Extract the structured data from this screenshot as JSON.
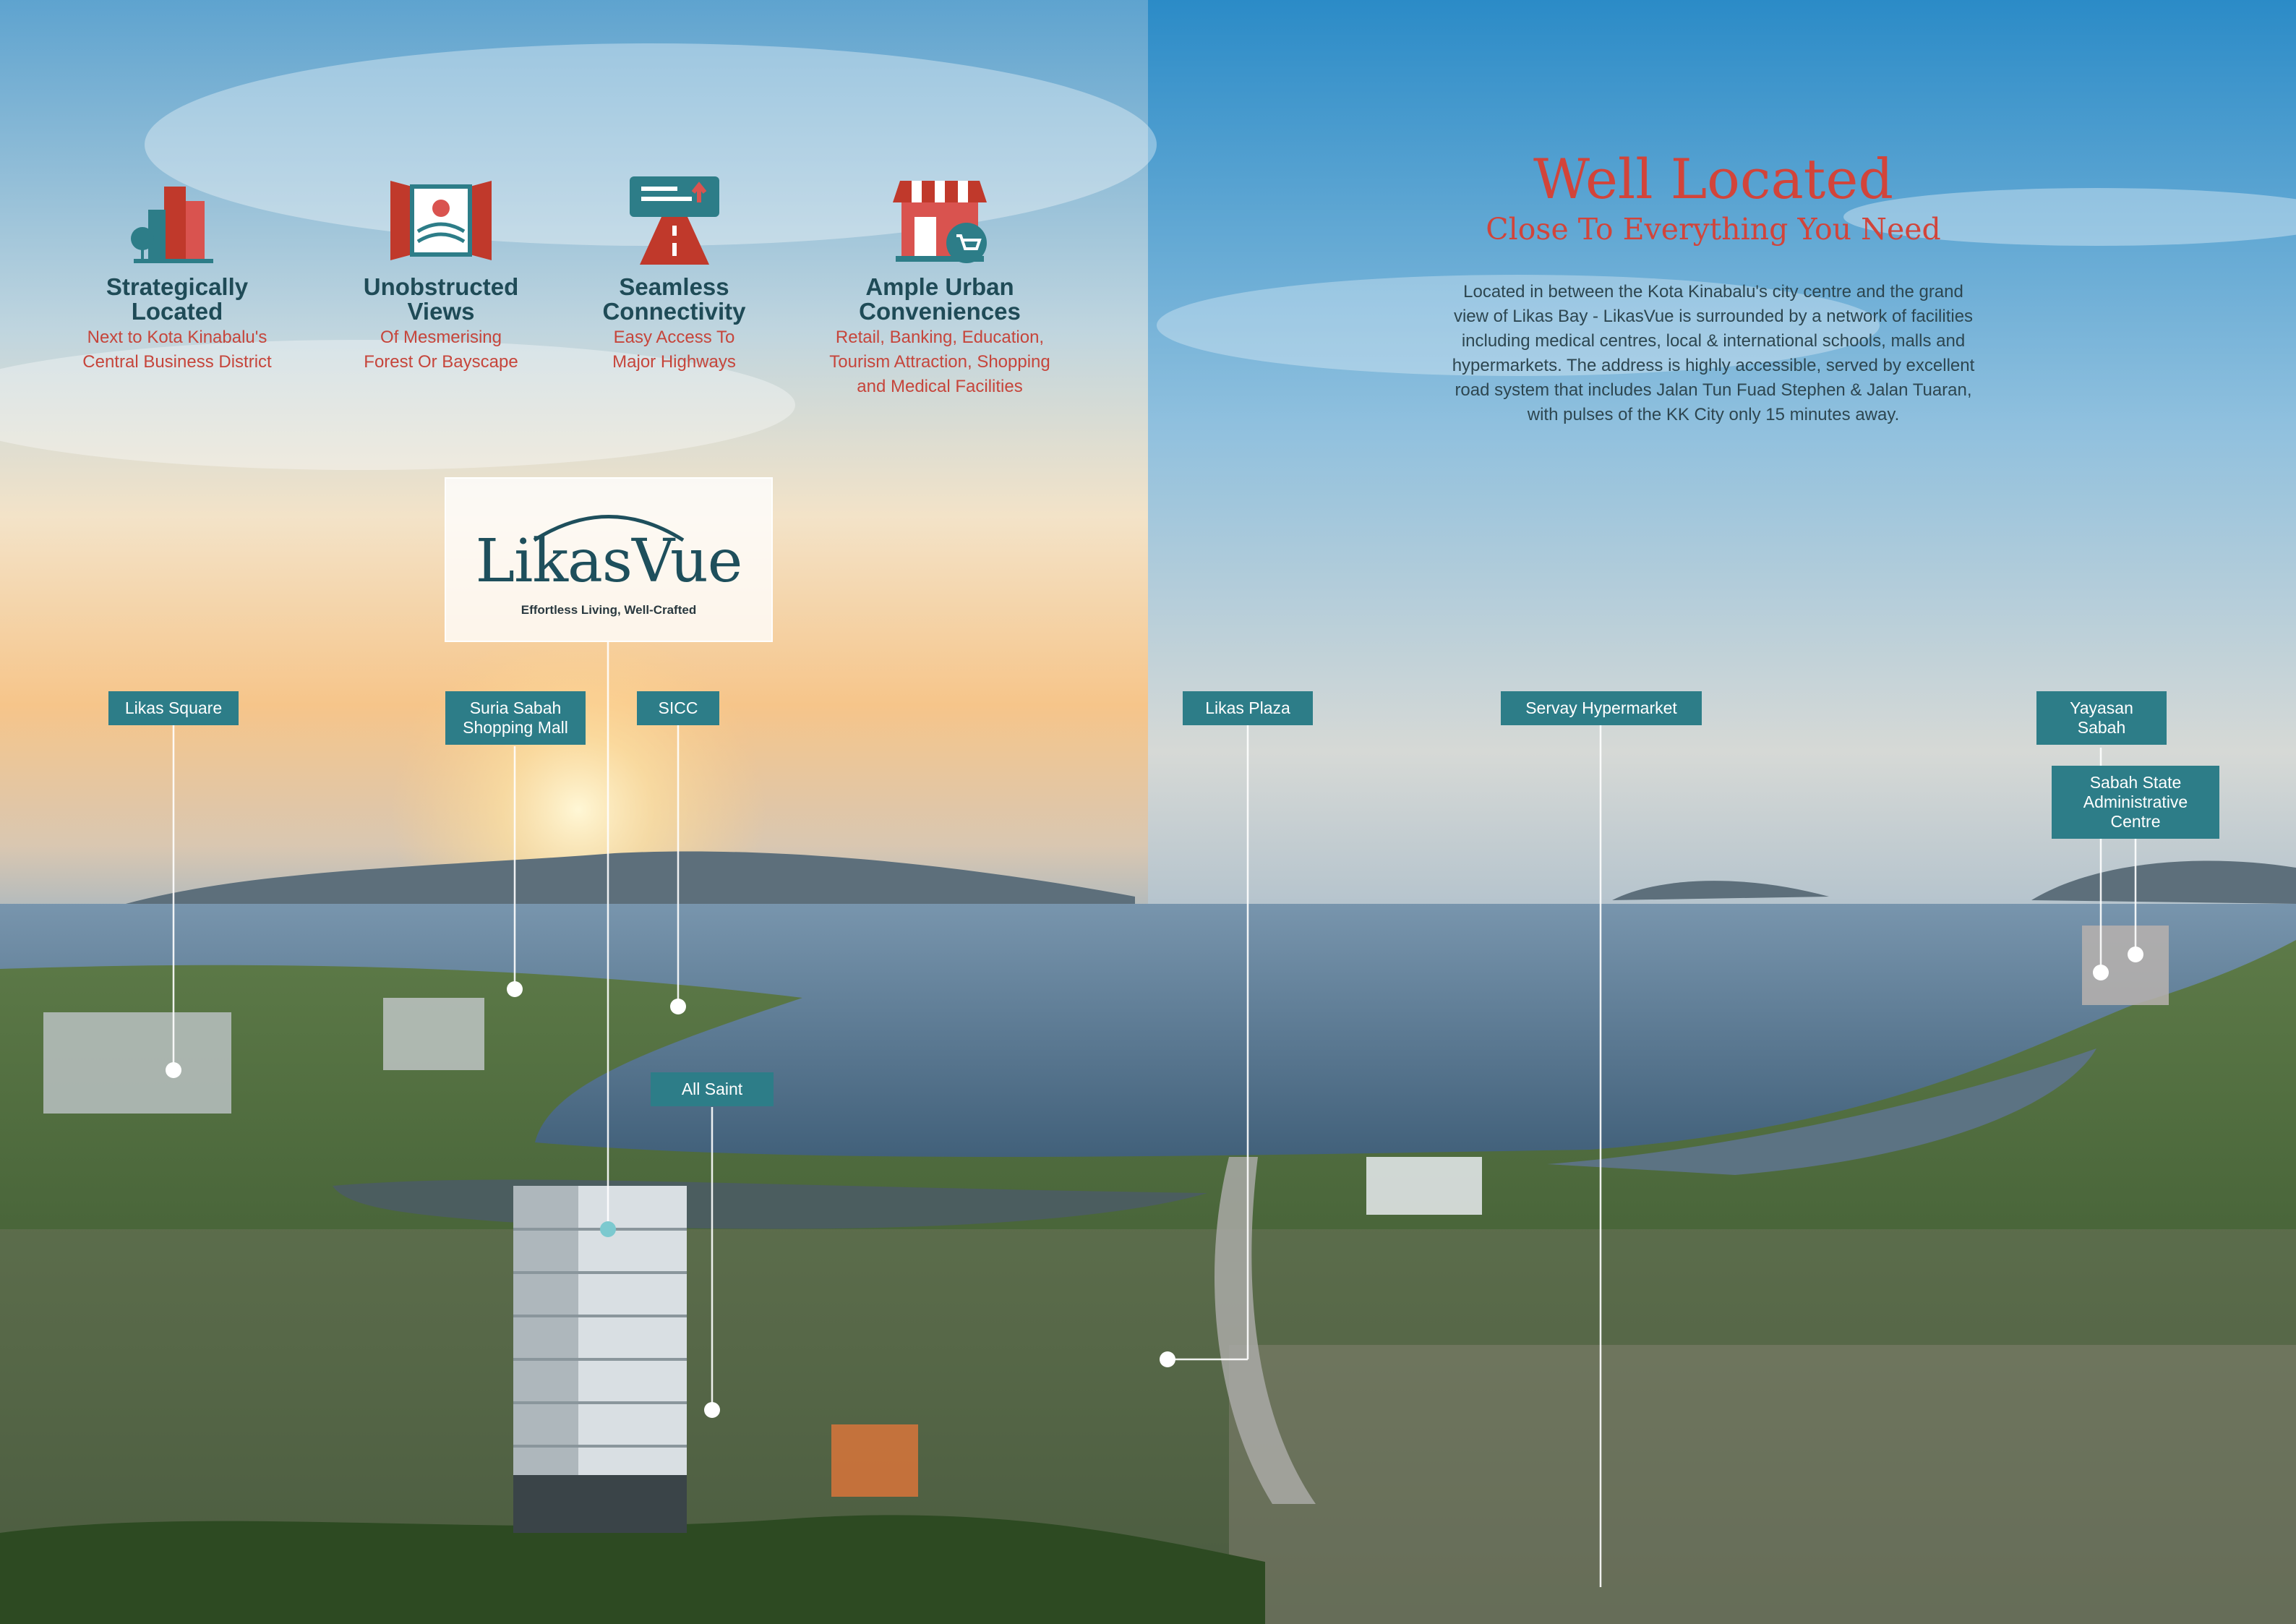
{
  "features": [
    {
      "icon": "city-buildings-icon",
      "title_line1": "Strategically",
      "title_line2": "Located",
      "sub_line1": "Next to Kota Kinabalu's",
      "sub_line2": "Central Business District"
    },
    {
      "icon": "window-view-icon",
      "title_line1": "Unobstructed",
      "title_line2": "Views",
      "sub_line1": "Of Mesmerising",
      "sub_line2": "Forest Or Bayscape"
    },
    {
      "icon": "highway-road-icon",
      "title_line1": "Seamless",
      "title_line2": "Connectivity",
      "sub_line1": "Easy Access To",
      "sub_line2": "Major Highways"
    },
    {
      "icon": "shop-cart-icon",
      "title_line1": "Ample Urban",
      "title_line2": "Conveniences",
      "sub_line1": "Retail, Banking, Education,",
      "sub_line2": "Tourism Attraction, Shopping",
      "sub_line3": "and Medical Facilities"
    }
  ],
  "hero": {
    "title": "Well Located",
    "subtitle": "Close To Everything You Need",
    "body_lines": [
      "Located in between the Kota Kinabalu's city centre and the grand",
      "view of Likas Bay - LikasVue is surrounded by a network of facilities",
      "including medical centres, local & international schools, malls and",
      "hypermarkets. The address is highly accessible, served by excellent",
      "road system that includes Jalan Tun Fuad Stephen & Jalan Tuaran,",
      "with pulses of the KK City only 15 minutes away."
    ]
  },
  "logo": {
    "wordmark": "LikasVue",
    "tagline": "Effortless Living, Well-Crafted"
  },
  "pois": [
    {
      "line1": "Likas Square"
    },
    {
      "line1": "Suria Sabah",
      "line2": "Shopping Mall"
    },
    {
      "line1": "SICC"
    },
    {
      "line1": "All Saint"
    },
    {
      "line1": "Likas Plaza"
    },
    {
      "line1": "Servay Hypermarket"
    },
    {
      "line1": "Yayasan",
      "line2": "Sabah"
    },
    {
      "line1": "Sabah State",
      "line2": "Administrative",
      "line3": "Centre"
    }
  ],
  "colors": {
    "teal_label": "#2d7d88",
    "heading_teal": "#1f4b57",
    "accent_red": "#c6453b"
  }
}
